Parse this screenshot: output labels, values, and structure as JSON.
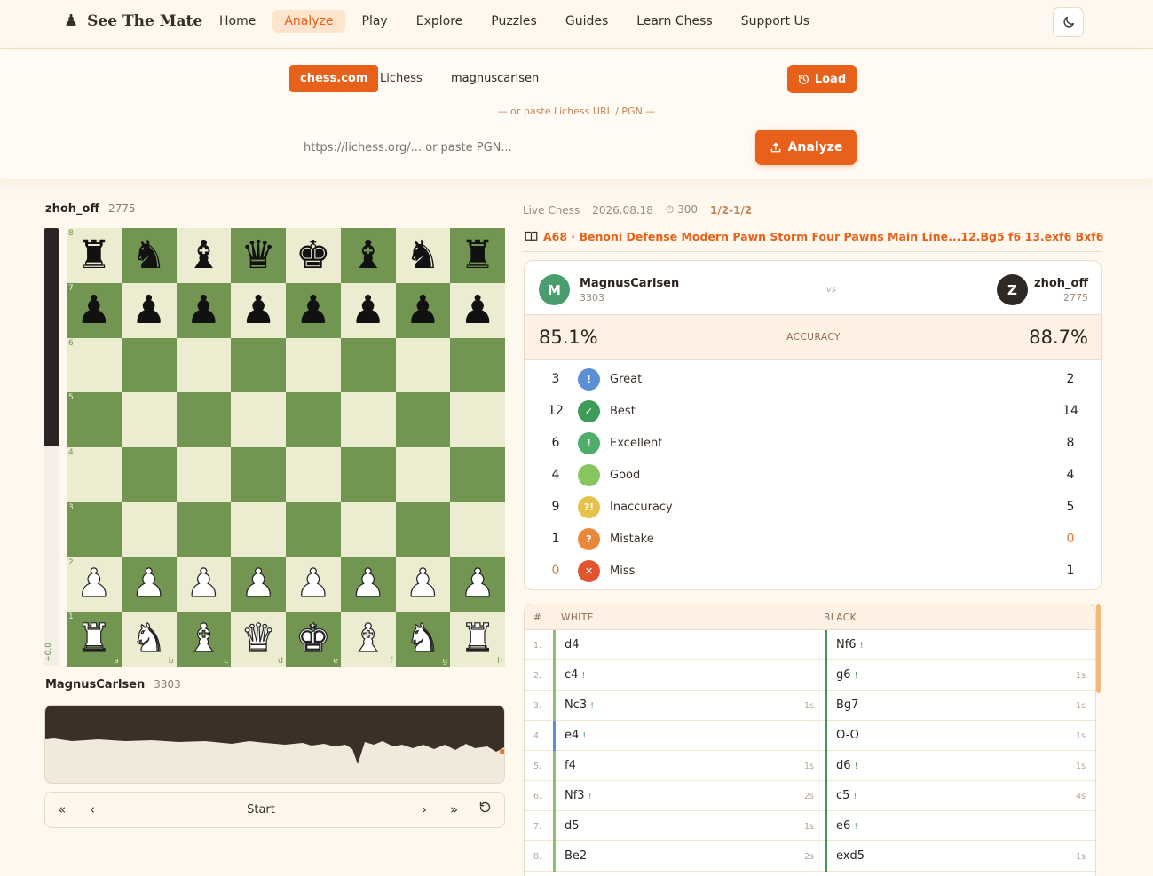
{
  "nav": {
    "logo": "See The Mate",
    "links": [
      "Home",
      "Analyze",
      "Play",
      "Explore",
      "Puzzles",
      "Guides",
      "Learn Chess",
      "Support Us"
    ],
    "active": "Analyze"
  },
  "loader": {
    "source_active": "chess.com",
    "source_inactive": "Lichess",
    "username": "magnuscarlsen",
    "load_label": "Load",
    "or_text": "— or paste Lichess URL / PGN —",
    "url_placeholder": "https://lichess.org/... or paste PGN...",
    "analyze_label": "Analyze"
  },
  "board": {
    "top_player": {
      "name": "zhoh_off",
      "rating": "2775"
    },
    "bottom_player": {
      "name": "MagnusCarlsen",
      "rating": "3303"
    },
    "eval": "+0.0",
    "files": [
      "a",
      "b",
      "c",
      "d",
      "e",
      "f",
      "g",
      "h"
    ],
    "ranks": [
      "8",
      "7",
      "6",
      "5",
      "4",
      "3",
      "2",
      "1"
    ],
    "rows": [
      [
        "br",
        "bn",
        "bb",
        "bq",
        "bk",
        "bb",
        "bn",
        "br"
      ],
      [
        "bp",
        "bp",
        "bp",
        "bp",
        "bp",
        "bp",
        "bp",
        "bp"
      ],
      [
        "",
        "",
        "",
        "",
        "",
        "",
        "",
        ""
      ],
      [
        "",
        "",
        "",
        "",
        "",
        "",
        "",
        ""
      ],
      [
        "",
        "",
        "",
        "",
        "",
        "",
        "",
        ""
      ],
      [
        "",
        "",
        "",
        "",
        "",
        "",
        "",
        ""
      ],
      [
        "wp",
        "wp",
        "wp",
        "wp",
        "wp",
        "wp",
        "wp",
        "wp"
      ],
      [
        "wr",
        "wn",
        "wb",
        "wq",
        "wk",
        "wb",
        "wn",
        "wr"
      ]
    ],
    "colors": {
      "light": "#ebecd0",
      "dark": "#739552"
    }
  },
  "controls": {
    "label": "Start"
  },
  "game": {
    "type": "Live Chess",
    "date": "2026.08.18",
    "time_control": "300",
    "result": "1/2-1/2",
    "opening": "A68 · Benoni Defense Modern Pawn Storm Four Pawns Main Line...12.Bg5 f6 13.exf6 Bxf6"
  },
  "summary": {
    "white": {
      "initial": "M",
      "name": "MagnusCarlsen",
      "rating": "3303",
      "accuracy": "85.1%"
    },
    "black": {
      "initial": "Z",
      "name": "zhoh_off",
      "rating": "2775",
      "accuracy": "88.7%"
    },
    "vs": "vs",
    "accuracy_label": "ACCURACY",
    "classifications": [
      {
        "name": "Great",
        "white": "3",
        "black": "2",
        "color": "#5b8fd6",
        "symbol": "!"
      },
      {
        "name": "Best",
        "white": "12",
        "black": "14",
        "color": "#3e9b57",
        "symbol": "✓"
      },
      {
        "name": "Excellent",
        "white": "6",
        "black": "8",
        "color": "#4fad6a",
        "symbol": "!"
      },
      {
        "name": "Good",
        "white": "4",
        "black": "4",
        "color": "#86c560",
        "symbol": ""
      },
      {
        "name": "Inaccuracy",
        "white": "9",
        "black": "5",
        "color": "#e8c14a",
        "symbol": "?!"
      },
      {
        "name": "Mistake",
        "white": "1",
        "black": "0",
        "color": "#e8893a",
        "symbol": "?"
      },
      {
        "name": "Miss",
        "white": "0",
        "black": "1",
        "color": "#e0542e",
        "symbol": "✕"
      }
    ]
  },
  "moves": {
    "headers": {
      "num": "#",
      "white": "WHITE",
      "black": "BLACK"
    },
    "rows": [
      {
        "n": "1.",
        "w": "d4",
        "wtag": "",
        "wt": "",
        "b": "Nf6",
        "btag": "!",
        "bt": ""
      },
      {
        "n": "2.",
        "w": "c4",
        "wtag": "!",
        "wt": "",
        "b": "g6",
        "btag": "!",
        "bt": "1s"
      },
      {
        "n": "3.",
        "w": "Nc3",
        "wtag": "!",
        "wt": "1s",
        "b": "Bg7",
        "btag": "",
        "bt": "1s"
      },
      {
        "n": "4.",
        "w": "e4",
        "wtag": "!",
        "wt": "",
        "b": "O-O",
        "btag": "",
        "bt": "1s"
      },
      {
        "n": "5.",
        "w": "f4",
        "wtag": "",
        "wt": "1s",
        "b": "d6",
        "btag": "!",
        "bt": "1s"
      },
      {
        "n": "6.",
        "w": "Nf3",
        "wtag": "!",
        "wt": "2s",
        "b": "c5",
        "btag": "!",
        "bt": "4s"
      },
      {
        "n": "7.",
        "w": "d5",
        "wtag": "",
        "wt": "1s",
        "b": "e6",
        "btag": "!",
        "bt": ""
      },
      {
        "n": "8.",
        "w": "Be2",
        "wtag": "",
        "wt": "2s",
        "b": "exd5",
        "btag": "",
        "bt": "1s"
      }
    ]
  }
}
